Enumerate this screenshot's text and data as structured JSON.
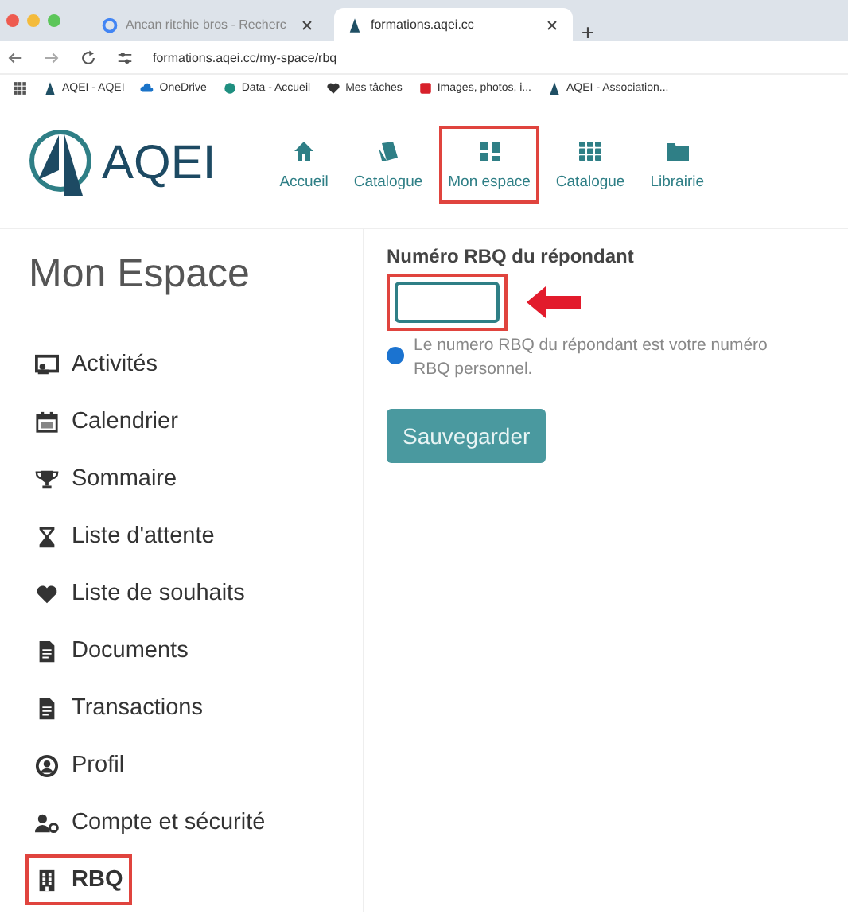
{
  "browser": {
    "tabs": [
      {
        "title": "Ancan ritchie bros - Recherc",
        "selected": false
      },
      {
        "title": "formations.aqei.cc",
        "selected": true
      }
    ],
    "url": "formations.aqei.cc/my-space/rbq",
    "bookmarks": [
      {
        "label": "AQEI - AQEI"
      },
      {
        "label": "OneDrive"
      },
      {
        "label": "Data - Accueil"
      },
      {
        "label": "Mes tâches"
      },
      {
        "label": "Images, photos, i..."
      },
      {
        "label": "AQEI - Association..."
      }
    ]
  },
  "header": {
    "logo": "AQEI",
    "nav": [
      {
        "label": "Accueil",
        "highlighted": false
      },
      {
        "label": "Catalogue",
        "highlighted": false
      },
      {
        "label": "Mon espace",
        "highlighted": true
      },
      {
        "label": "Catalogue",
        "highlighted": false
      },
      {
        "label": "Librairie",
        "highlighted": false
      }
    ]
  },
  "sidebar": {
    "title": "Mon Espace",
    "items": [
      {
        "label": "Activités",
        "highlighted": false
      },
      {
        "label": "Calendrier",
        "highlighted": false
      },
      {
        "label": "Sommaire",
        "highlighted": false
      },
      {
        "label": "Liste d'attente",
        "highlighted": false
      },
      {
        "label": "Liste de souhaits",
        "highlighted": false
      },
      {
        "label": "Documents",
        "highlighted": false
      },
      {
        "label": "Transactions",
        "highlighted": false
      },
      {
        "label": "Profil",
        "highlighted": false
      },
      {
        "label": "Compte et sécurité",
        "highlighted": false
      },
      {
        "label": "RBQ",
        "highlighted": true
      }
    ]
  },
  "form": {
    "label": "Numéro RBQ du répondant",
    "input_highlighted": true,
    "hint": "Le numero RBQ du répondant est votre numéro RBQ personnel.",
    "button": "Sauvegarder"
  }
}
